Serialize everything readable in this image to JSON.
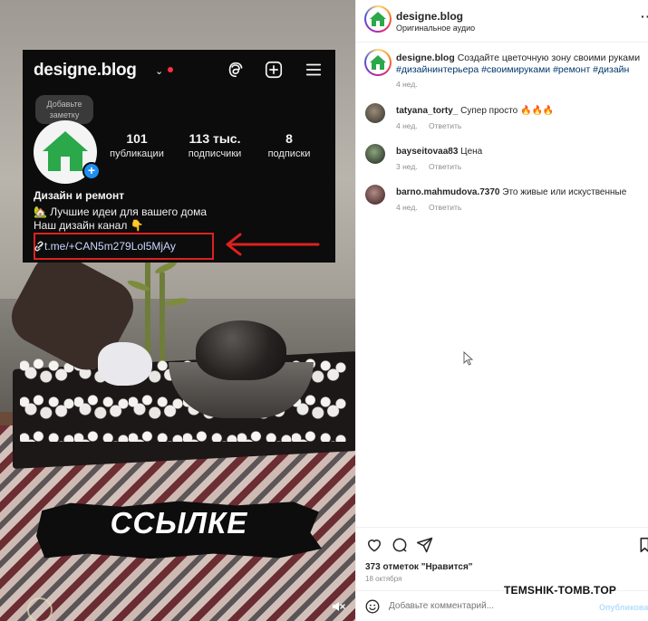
{
  "video": {
    "profile_username": "designe.blog",
    "note_bubble": "Добавьте заметку",
    "stats": [
      {
        "value": "101",
        "label": "публикации"
      },
      {
        "value": "113 тыс.",
        "label": "подписчики"
      },
      {
        "value": "8",
        "label": "подписки"
      }
    ],
    "bio_name": "Дизайн и ремонт",
    "bio_line1": "🏡 Лучшие идеи для вашего дома",
    "bio_line2": "Наш дизайн канал 👇",
    "bio_link": "t.me/+CAN5m279Lol5MjAy",
    "caption_word": "ССЫЛКЕ",
    "highlight_color": "#e02020"
  },
  "post": {
    "header": {
      "username": "designe.blog",
      "audio": "Оригинальное аудио"
    },
    "caption": {
      "username": "designe.blog",
      "text": "Создайте цветочную зону своими руками",
      "hashtags": "#дизайнинтерьера #своимируками #ремонт #дизайн",
      "time": "4 нед."
    },
    "comments": [
      {
        "username": "tatyana_torty_",
        "text": "Супер просто 🔥🔥🔥",
        "time": "4 нед.",
        "reply": "Ответить"
      },
      {
        "username": "bayseitovaa83",
        "text": "Цена",
        "time": "3 нед.",
        "reply": "Ответить"
      },
      {
        "username": "barno.mahmudova.7370",
        "text": "Это живые или искуственные",
        "time": "4 нед.",
        "reply": "Ответить"
      }
    ],
    "likes": "373 отметок \"Нравится\"",
    "date": "18 октября",
    "comment_placeholder": "Добавьте комментарий...",
    "post_button": "Опубликовать"
  },
  "watermark": "TEMSHIK-TOMB.TOP",
  "icons": [
    "threads-icon",
    "add-post-icon",
    "menu-icon",
    "heart-icon",
    "comment-icon",
    "share-icon",
    "save-icon",
    "emoji-icon",
    "more-icon",
    "link-icon",
    "mute-icon"
  ]
}
